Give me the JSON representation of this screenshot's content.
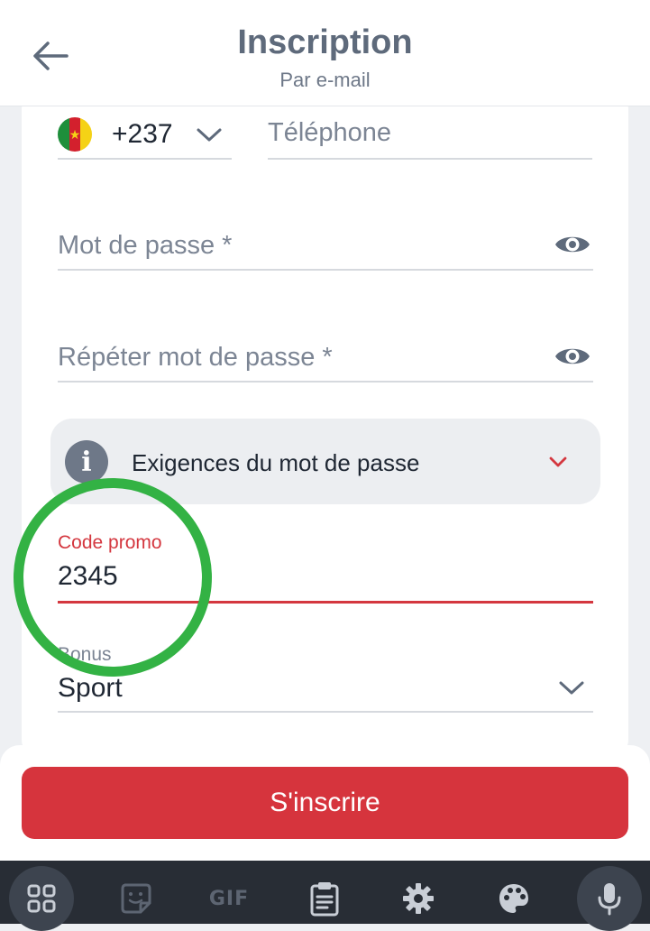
{
  "header": {
    "title": "Inscription",
    "subtitle": "Par e-mail"
  },
  "phone": {
    "dial_code": "+237",
    "placeholder": "Téléphone"
  },
  "password": {
    "placeholder": "Mot de passe *"
  },
  "repeat_password": {
    "placeholder": "Répéter mot de passe *"
  },
  "requirements": {
    "label": "Exigences du mot de passe"
  },
  "promo": {
    "label": "Code promo",
    "value": "2345"
  },
  "bonus": {
    "label": "Bonus",
    "value": "Sport"
  },
  "submit": {
    "label": "S'inscrire"
  },
  "keyboard": {
    "gif_label": "GIF"
  },
  "colors": {
    "accent_red": "#d6343d",
    "highlight_green": "#33b244"
  },
  "icons": {
    "back": "arrow-left-icon",
    "phone_flag": "cameroon-flag-icon",
    "dropdown": "chevron-down-icon",
    "visibility": "eye-icon",
    "info": "info-icon",
    "keyboard": [
      "apps-grid-icon",
      "sticker-icon",
      "gif-icon",
      "clipboard-icon",
      "gear-icon",
      "palette-icon",
      "microphone-icon"
    ]
  }
}
